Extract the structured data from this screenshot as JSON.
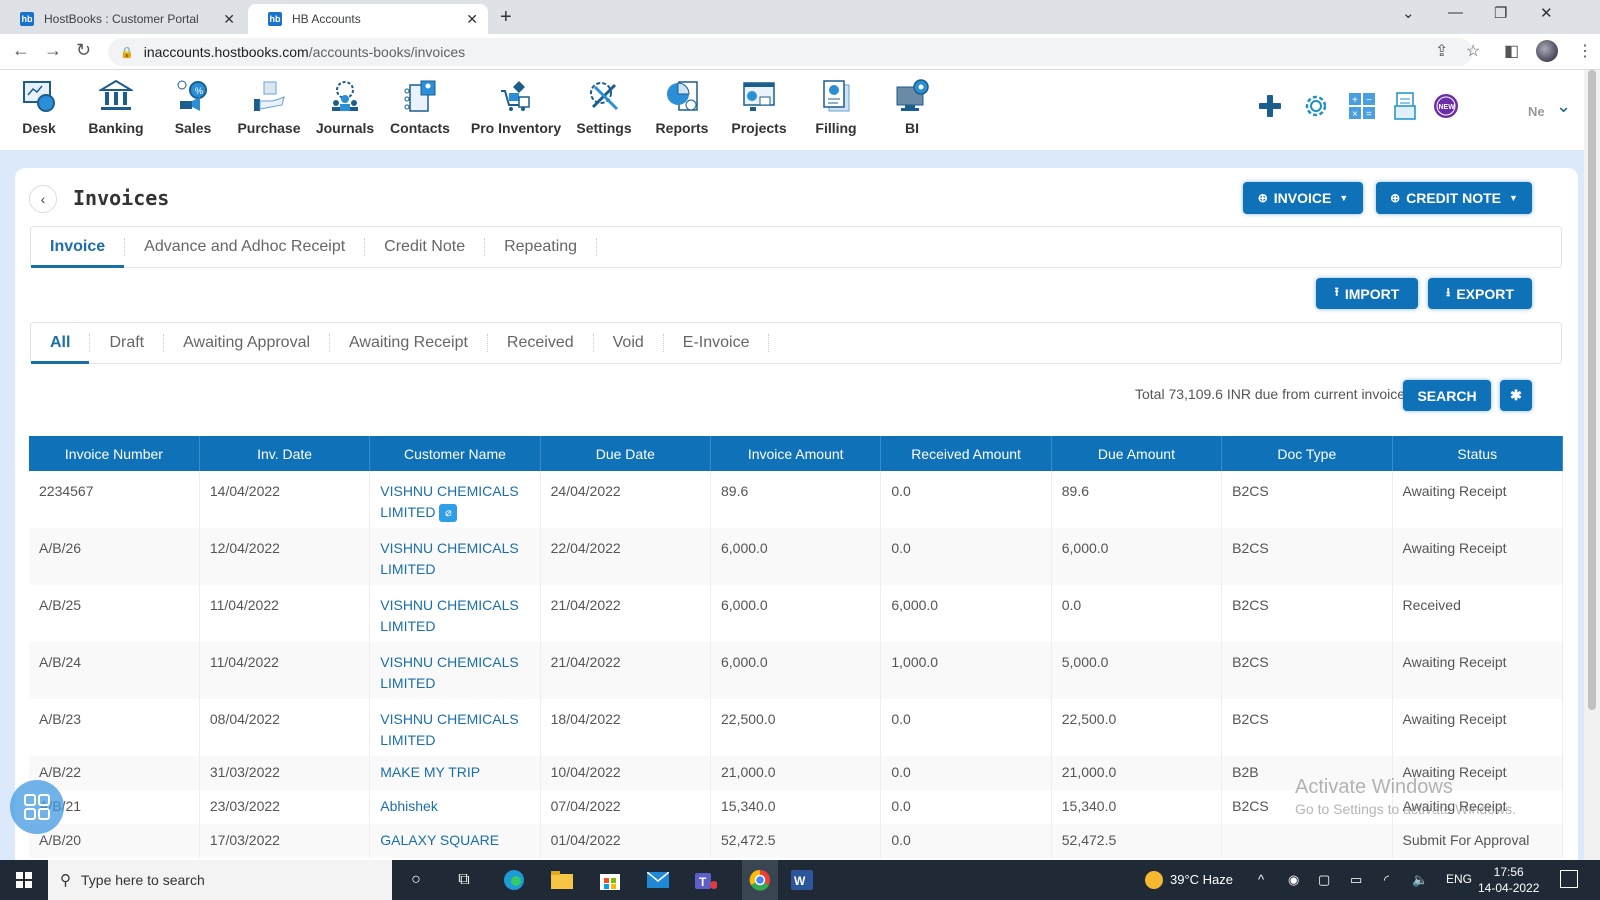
{
  "browser": {
    "tabs": [
      {
        "label": "HostBooks : Customer Portal",
        "favicon": "hb"
      },
      {
        "label": "HB Accounts",
        "favicon": "hb"
      }
    ],
    "url_host": "inaccounts.hostbooks.com",
    "url_path": "/accounts-books/invoices"
  },
  "app_nav": {
    "items": [
      {
        "label": "Desk",
        "icon": "desk-icon"
      },
      {
        "label": "Banking",
        "icon": "banking-icon"
      },
      {
        "label": "Sales",
        "icon": "sales-icon"
      },
      {
        "label": "Purchase",
        "icon": "purchase-icon"
      },
      {
        "label": "Journals",
        "icon": "journals-icon"
      },
      {
        "label": "Contacts",
        "icon": "contacts-icon"
      },
      {
        "label": "Pro Inventory",
        "icon": "inventory-icon"
      },
      {
        "label": "Settings",
        "icon": "settings-icon"
      },
      {
        "label": "Reports",
        "icon": "reports-icon"
      },
      {
        "label": "Projects",
        "icon": "projects-icon"
      },
      {
        "label": "Filling",
        "icon": "filling-icon"
      },
      {
        "label": "BI",
        "icon": "bi-icon"
      }
    ],
    "user_label": "Ne",
    "new_badge": "NEW"
  },
  "page": {
    "title": "Invoices",
    "invoice_button": "INVOICE",
    "credit_note_button": "CREDIT NOTE",
    "main_tabs": [
      "Invoice",
      "Advance and Adhoc Receipt",
      "Credit Note",
      "Repeating"
    ],
    "import_button": "IMPORT",
    "export_button": "EXPORT",
    "status_tabs": [
      "All",
      "Draft",
      "Awaiting Approval",
      "Awaiting Receipt",
      "Received",
      "Void",
      "E-Invoice"
    ],
    "total_text": "Total 73,109.6 INR due from current invoices",
    "search_button": "SEARCH"
  },
  "table": {
    "columns": [
      "Invoice Number",
      "Inv. Date",
      "Customer Name",
      "Due Date",
      "Invoice Amount",
      "Received Amount",
      "Due Amount",
      "Doc Type",
      "Status"
    ],
    "rows": [
      {
        "number": "2234567",
        "inv_date": "14/04/2022",
        "customer": "VISHNU CHEMICALS LIMITED",
        "attachment": true,
        "due_date": "24/04/2022",
        "invoice_amount": "89.6",
        "received_amount": "0.0",
        "due_amount": "89.6",
        "doc_type": "B2CS",
        "status": "Awaiting Receipt"
      },
      {
        "number": "A/B/26",
        "inv_date": "12/04/2022",
        "customer": "VISHNU CHEMICALS LIMITED",
        "attachment": false,
        "due_date": "22/04/2022",
        "invoice_amount": "6,000.0",
        "received_amount": "0.0",
        "due_amount": "6,000.0",
        "doc_type": "B2CS",
        "status": "Awaiting Receipt"
      },
      {
        "number": "A/B/25",
        "inv_date": "11/04/2022",
        "customer": "VISHNU CHEMICALS LIMITED",
        "attachment": false,
        "due_date": "21/04/2022",
        "invoice_amount": "6,000.0",
        "received_amount": "6,000.0",
        "due_amount": "0.0",
        "doc_type": "B2CS",
        "status": "Received"
      },
      {
        "number": "A/B/24",
        "inv_date": "11/04/2022",
        "customer": "VISHNU CHEMICALS LIMITED",
        "attachment": false,
        "due_date": "21/04/2022",
        "invoice_amount": "6,000.0",
        "received_amount": "1,000.0",
        "due_amount": "5,000.0",
        "doc_type": "B2CS",
        "status": "Awaiting Receipt"
      },
      {
        "number": "A/B/23",
        "inv_date": "08/04/2022",
        "customer": "VISHNU CHEMICALS LIMITED",
        "attachment": false,
        "due_date": "18/04/2022",
        "invoice_amount": "22,500.0",
        "received_amount": "0.0",
        "due_amount": "22,500.0",
        "doc_type": "B2CS",
        "status": "Awaiting Receipt"
      },
      {
        "number": "A/B/22",
        "inv_date": "31/03/2022",
        "customer": "MAKE MY TRIP",
        "attachment": false,
        "due_date": "10/04/2022",
        "invoice_amount": "21,000.0",
        "received_amount": "0.0",
        "due_amount": "21,000.0",
        "doc_type": "B2B",
        "status": "Awaiting Receipt"
      },
      {
        "number": "A/B/21",
        "inv_date": "23/03/2022",
        "customer": "Abhishek",
        "attachment": false,
        "due_date": "07/04/2022",
        "invoice_amount": "15,340.0",
        "received_amount": "0.0",
        "due_amount": "15,340.0",
        "doc_type": "B2CS",
        "status": "Awaiting Receipt"
      },
      {
        "number": "A/B/20",
        "inv_date": "17/03/2022",
        "customer": "GALAXY SQUARE",
        "attachment": false,
        "due_date": "01/04/2022",
        "invoice_amount": "52,472.5",
        "received_amount": "0.0",
        "due_amount": "52,472.5",
        "doc_type": "",
        "status": "Submit For Approval"
      }
    ]
  },
  "watermark": {
    "line1": "Activate Windows",
    "line2": "Go to Settings to activate Windows."
  },
  "taskbar": {
    "search_placeholder": "Type here to search",
    "weather": "39°C  Haze",
    "language": "ENG",
    "time": "17:56",
    "date": "14-04-2022"
  },
  "colors": {
    "primary": "#0f72b8",
    "page_bg": "#dbe9fb",
    "link": "#1b6fa8"
  }
}
